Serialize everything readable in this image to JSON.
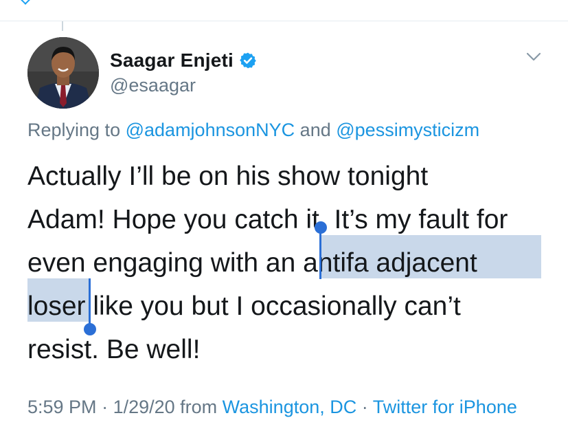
{
  "author": {
    "display_name": "Saagar Enjeti",
    "handle": "@esaagar",
    "verified": true
  },
  "reply": {
    "prefix": "Replying to",
    "user1": "@adamjohnsonNYC",
    "connector": "and",
    "user2": "@pessimysticizm"
  },
  "tweet": {
    "line1": "Actually I’ll be on his show tonight",
    "line2": "Adam! Hope you catch it. It’s my fault for",
    "line3_plain": "even engaging with an ",
    "line3_selected": "antifa adjacent",
    "line4_selected": "loser",
    "line4_plain": " like you but I occasionally can’t",
    "line5": "resist. Be well!"
  },
  "meta": {
    "time": "5:59 PM",
    "sep1": " · ",
    "date": "1/29/20",
    "from": " from ",
    "location": "Washington, DC",
    "sep2": " · ",
    "source": "Twitter for iPhone"
  },
  "colors": {
    "link": "#1b95e0",
    "verified": "#1da1f2",
    "selection": "#c9d8ea",
    "selection_handle": "#2b6fd6",
    "secondary_text": "#657786"
  },
  "icons": {
    "back": "chevron-left-icon",
    "verified": "verified-badge-icon",
    "more": "chevron-down-icon"
  }
}
